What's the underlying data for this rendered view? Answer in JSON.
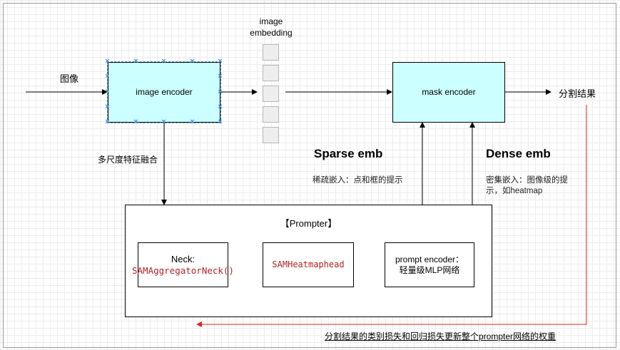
{
  "labels": {
    "image_in": "图像",
    "image_embedding": "image\nembedding",
    "segmentation_out": "分割结果",
    "multi_scale": "多尺度特征融合",
    "sparse_title": "Sparse emb",
    "sparse_desc": "稀疏嵌入：点和框的提示",
    "dense_title": "Dense emb",
    "dense_desc": "密集嵌入：图像级的提\n示，如heatmap",
    "loss_note": "分割结果的类别损失和回归损失更新整个prompter网络的权重"
  },
  "nodes": {
    "image_encoder": "image encoder",
    "mask_encoder": "mask encoder",
    "prompter": "【Prompter】",
    "neck_title": "Neck:",
    "neck_code": "SAMAggregatorNeck()",
    "heatmap_head": "SAMHeatmaphead",
    "prompt_encoder": "prompt encoder：\n轻量级MLP网络"
  },
  "colors": {
    "box_fill": "#ccffff",
    "feedback_arrow": "#e8201a",
    "code_text": "#b22222"
  }
}
